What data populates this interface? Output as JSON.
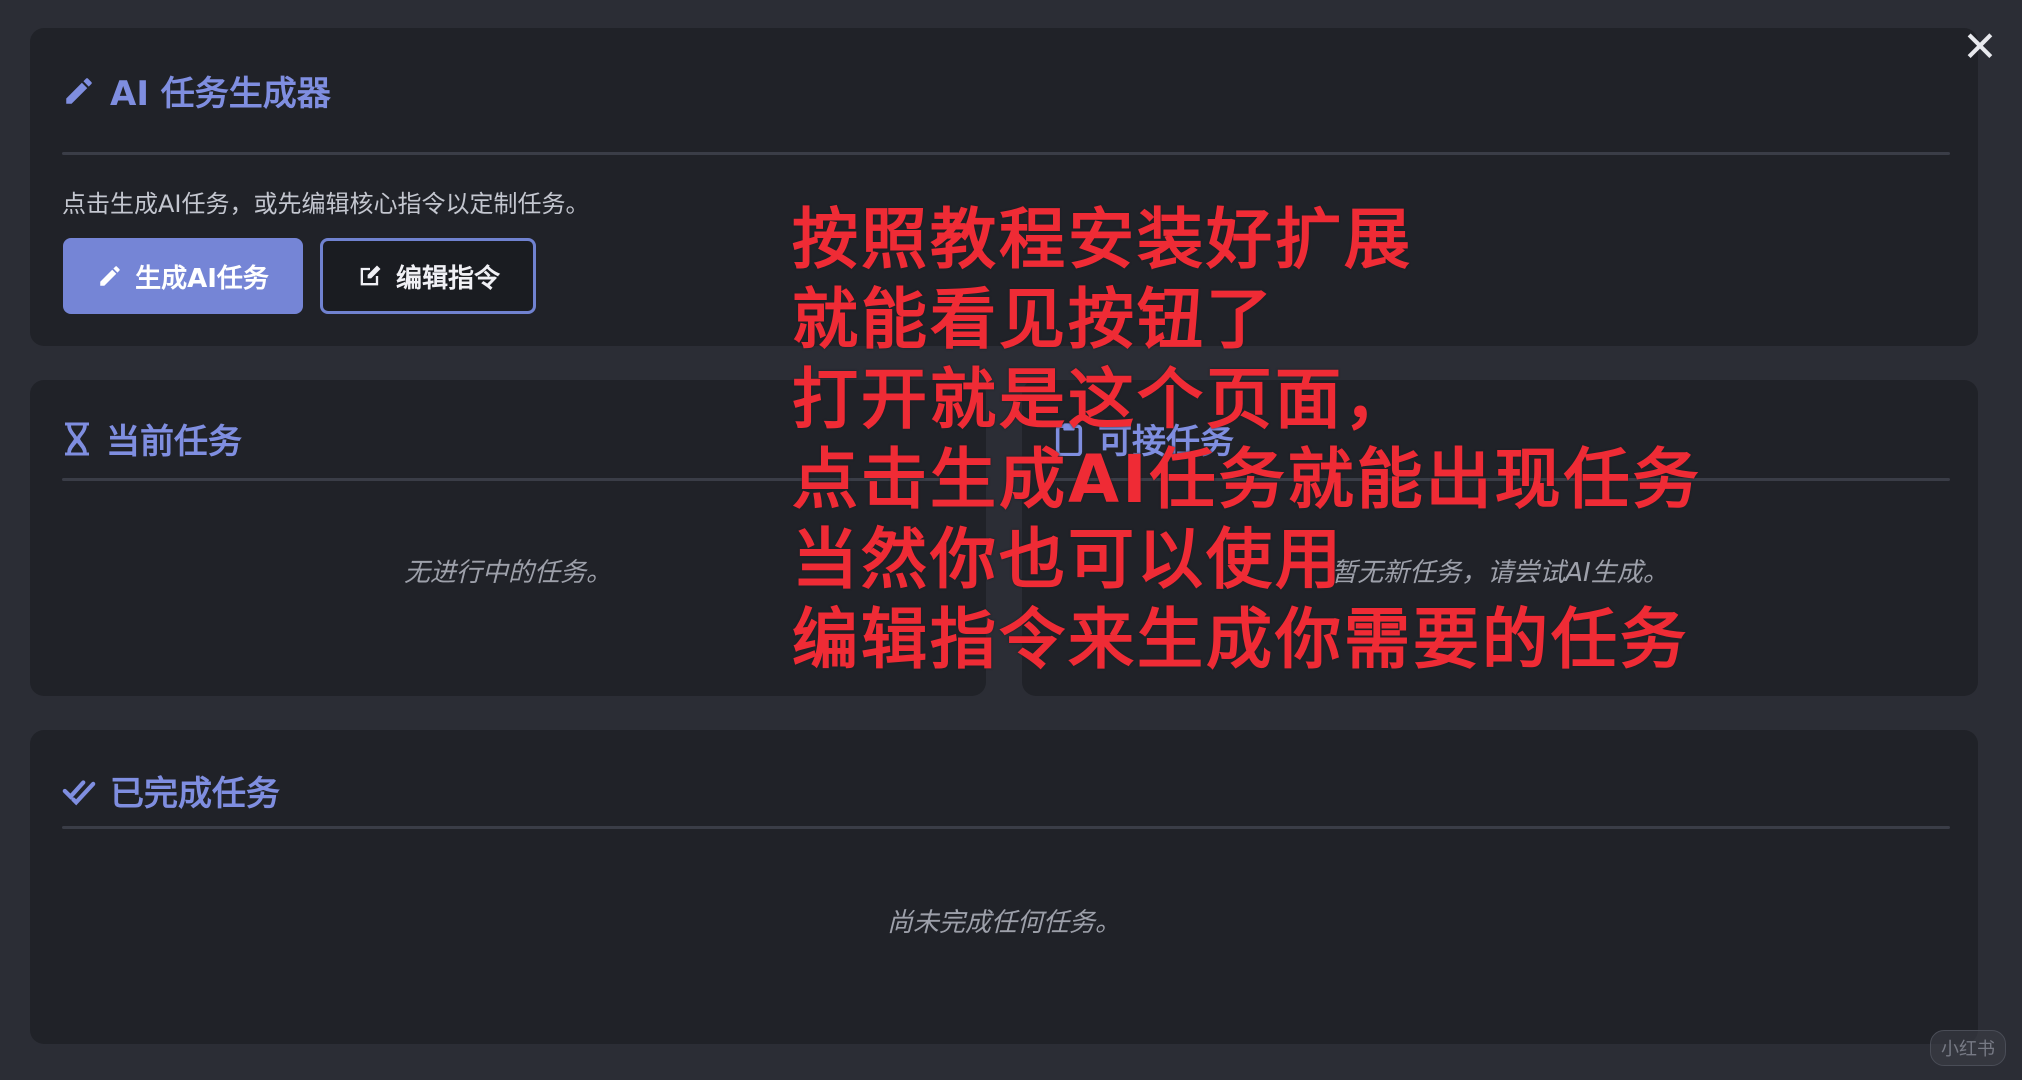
{
  "generator": {
    "title": "AI 任务生成器",
    "title_icon": "pencil-icon",
    "description": "点击生成AI任务，或先编辑核心指令以定制任务。",
    "generate_button": "生成AI任务",
    "edit_button": "编辑指令"
  },
  "current_tasks": {
    "title": "当前任务",
    "icon": "hourglass-icon",
    "empty_text": "无进行中的任务。"
  },
  "available_tasks": {
    "title": "可接任务",
    "icon": "clipboard-icon",
    "empty_text": "暂无新任务，请尝试AI生成。"
  },
  "completed_tasks": {
    "title": "已完成任务",
    "icon": "double-check-icon",
    "empty_text": "尚未完成任何任务。"
  },
  "annotation": {
    "color": "#ef2b35",
    "lines": [
      "按照教程安装好扩展",
      "就能看见按钮了",
      "打开就是这个页面，",
      "点击生成AI任务就能出现任务",
      "当然你也可以使用",
      "编辑指令来生成你需要的任务"
    ]
  },
  "watermark": "小红书",
  "colors": {
    "accent": "#7f8ee0",
    "card_bg": "#202228",
    "page_bg": "#2b2d35",
    "primary_button": "#7585d6"
  }
}
